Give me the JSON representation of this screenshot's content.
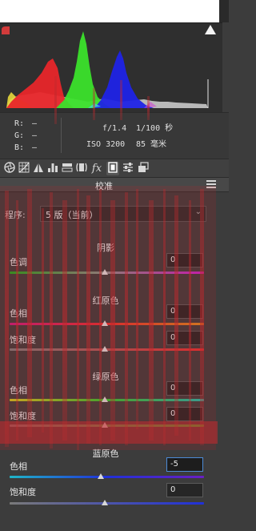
{
  "readout": {
    "r_label": "R:",
    "g_label": "G:",
    "b_label": "B:",
    "r_value": "—",
    "g_value": "—",
    "b_value": "—",
    "aperture": "f/1.4",
    "shutter": "1/100 秒",
    "iso": "ISO 3200",
    "focal": "85 毫米"
  },
  "panel": {
    "title": "校准"
  },
  "process": {
    "label": "程序:",
    "value": "5 版（当前）"
  },
  "sections": {
    "shadows": {
      "title": "阴影",
      "tint_label": "色调",
      "tint_value": "0"
    },
    "red": {
      "title": "红原色",
      "hue_label": "色相",
      "hue_value": "0",
      "sat_label": "饱和度",
      "sat_value": "0"
    },
    "green": {
      "title": "绿原色",
      "hue_label": "色相",
      "hue_value": "0",
      "sat_label": "饱和度",
      "sat_value": "0"
    },
    "blue": {
      "title": "蓝原色",
      "hue_label": "色相",
      "hue_value": "-5",
      "sat_label": "饱和度",
      "sat_value": "0"
    }
  },
  "colors": {
    "panel_bg": "#3c3c3c",
    "histogram_red": "#e8262a",
    "histogram_green": "#3be12b",
    "histogram_blue": "#1f23e6",
    "focus_blue": "#4c8bd6"
  },
  "icons": {
    "toolbar": [
      "basic-aperture-icon",
      "tone-curve-grid-icon",
      "detail-triangle-icon",
      "hsl-bars-icon",
      "split-toning-icon",
      "lens-corrections-icon",
      "effects-fx-icon",
      "camera-calibration-film-icon",
      "presets-sliders-icon",
      "snapshots-icon"
    ]
  }
}
